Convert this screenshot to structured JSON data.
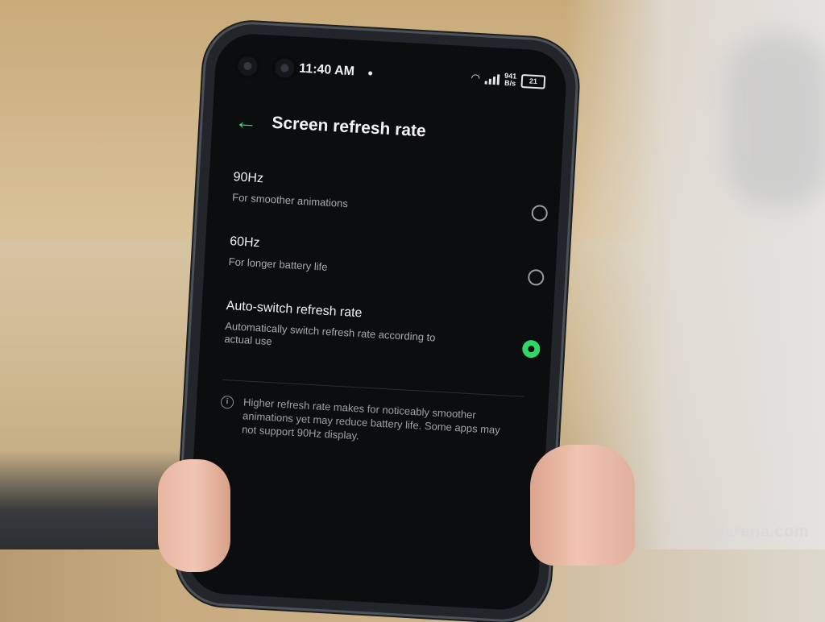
{
  "status_bar": {
    "time": "11:40 AM",
    "speed_value": "941",
    "speed_unit": "B/s",
    "battery": "21"
  },
  "header": {
    "back_icon": "arrow-left-icon",
    "title": "Screen refresh rate"
  },
  "options": [
    {
      "title": "90Hz",
      "subtitle": "For smoother animations",
      "selected": false
    },
    {
      "title": "60Hz",
      "subtitle": "For longer battery life",
      "selected": false
    },
    {
      "title": "Auto-switch refresh rate",
      "subtitle": "Automatically switch refresh rate according to actual use",
      "selected": true
    }
  ],
  "note": {
    "icon": "info-icon",
    "text": "Higher refresh rate makes for noticeably smoother animations yet may reduce battery life. Some apps may not support 90Hz display."
  },
  "watermark": "GSMarena.com",
  "colors": {
    "accent": "#2fd866",
    "screen_bg": "#0c0d0f"
  }
}
